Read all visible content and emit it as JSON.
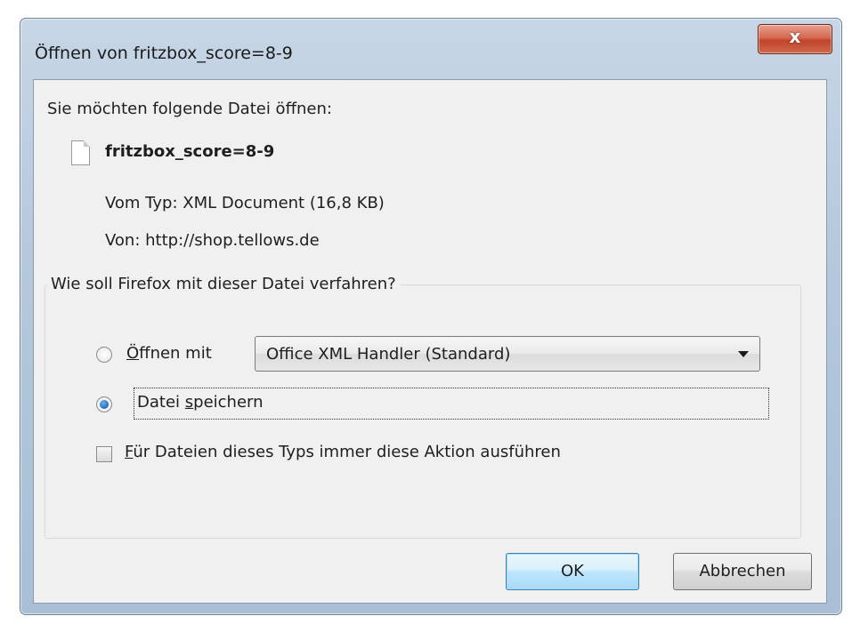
{
  "window": {
    "title": "Öffnen von fritzbox_score=8-9",
    "close_glyph": "x"
  },
  "dialog": {
    "prompt": "Sie möchten folgende Datei öffnen:",
    "file_icon": "document-icon",
    "file_name": "fritzbox_score=8-9",
    "type_line": "Vom Typ: XML Document (16,8 KB)",
    "from_line": "Von: http://shop.tellows.de"
  },
  "action_group": {
    "legend": "Wie soll Firefox mit dieser Datei verfahren?",
    "open_with": {
      "label_mnemonic": "Ö",
      "label_rest": "ffnen mit",
      "checked": false,
      "handler": "Office XML Handler (Standard)"
    },
    "save_file": {
      "label_start": "Datei ",
      "label_mnemonic": "s",
      "label_rest": "peichern",
      "checked": true
    },
    "always": {
      "label_mnemonic": "F",
      "label_rest": "ür Dateien dieses Typs immer diese Aktion ausführen",
      "checked": false
    }
  },
  "buttons": {
    "ok": "OK",
    "cancel": "Abbrechen"
  },
  "colors": {
    "frame": "#b5c8dc",
    "close_button": "#c0432a",
    "client_bg": "#f0f0f0",
    "default_button": "#bee6fd"
  }
}
